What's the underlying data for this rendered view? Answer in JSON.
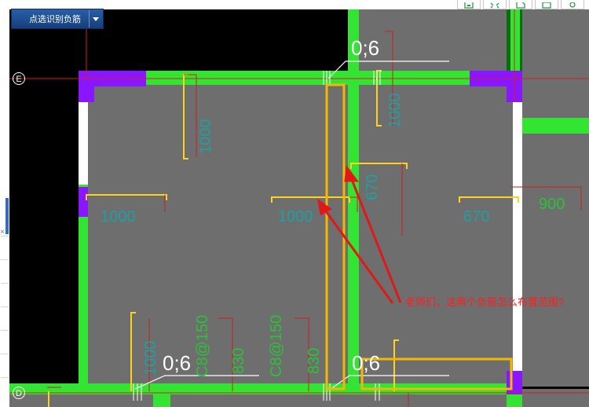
{
  "command_button": {
    "label": "点选识别负筋"
  },
  "toolbar": {
    "icons": [
      "save-icon",
      "fit-view-icon",
      "open-icon",
      "window-icon",
      "settings-icon"
    ]
  },
  "axes": {
    "top": "E",
    "bottom": "D"
  },
  "labels": {
    "rebar_top": "0;6",
    "rebar_bottom_left": "0;6",
    "rebar_bottom_right": "0;6",
    "dim_left": "1000",
    "dim_center": "1000",
    "dim_right_a": "670",
    "dim_right_b": "900",
    "dim_top_vertical": "1000",
    "dim_c8_a": "C8@150",
    "dim_830_a": "830",
    "dim_c8_b": "C8@150",
    "dim_830_b": "830",
    "dim_bottom_left_v": "1000"
  },
  "note": {
    "text": "老师们，这两个负筋怎么布置范围?"
  },
  "colors": {
    "background": "#000000",
    "slab": "#6e6e6e",
    "wall": "#33e433",
    "column": "#8a15ff",
    "rebar_yellow": "#ffd21e",
    "highlight_orange": "#f5b800",
    "axis_red": "#d62020",
    "arrow": "#e01818",
    "note_text": "#ff1e1e"
  }
}
